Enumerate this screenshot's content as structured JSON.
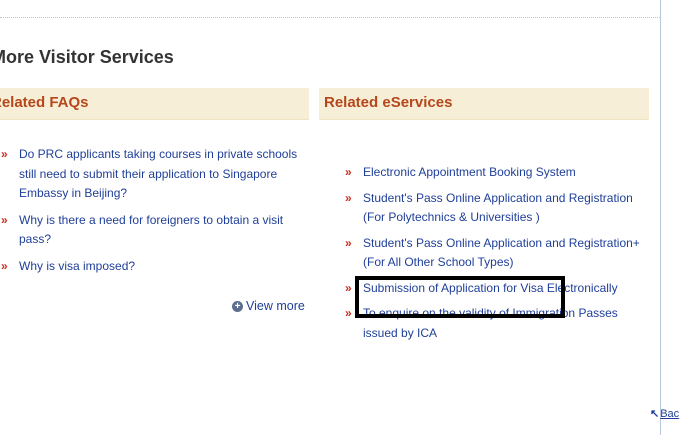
{
  "page": {
    "section_title": "More Visitor Services"
  },
  "faqs": {
    "header": "Related FAQs",
    "bullet": "»",
    "items": [
      {
        "label": "Do PRC applicants taking courses in private schools still need to submit their application to Singapore Embassy in Beijing?"
      },
      {
        "label": "Why is there a need for foreigners to obtain a visit pass?"
      },
      {
        "label": "Why is visa imposed?"
      }
    ],
    "view_more_label": "View more",
    "view_more_icon": "plus-circle-icon"
  },
  "eservices": {
    "header": "Related eServices",
    "items": [
      {
        "label": "Electronic Appointment Booking System"
      },
      {
        "label": "Student's Pass Online Application and Registration (For Polytechnics & Universities )"
      },
      {
        "label": "Student's Pass Online Application and Registration+ (For All Other School Types)"
      },
      {
        "label": "Submission of Application for Visa Electronically"
      },
      {
        "label": "To enquire on the validity of Immigration Passes issued by ICA"
      }
    ]
  },
  "footer": {
    "back_label": "Bac",
    "back_icon": "arrow-up-left-icon"
  },
  "colors": {
    "link": "#1f3f99",
    "bullet": "#cc2e22",
    "header_bg": "#f7eed8",
    "header_text": "#b5471b",
    "highlight_border": "#000000"
  }
}
